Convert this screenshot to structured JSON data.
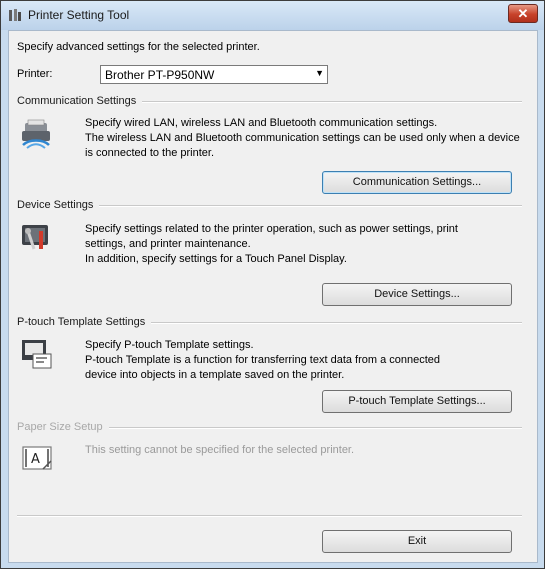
{
  "window": {
    "title": "Printer Setting Tool",
    "close_glyph": "✕"
  },
  "intro": "Specify advanced settings for the selected printer.",
  "printer": {
    "label": "Printer:",
    "value": "Brother PT-P950NW"
  },
  "sections": {
    "communication": {
      "header": "Communication Settings",
      "desc": [
        "Specify wired LAN, wireless LAN and Bluetooth communication settings.",
        "The wireless LAN and Bluetooth communication settings can be used only when a device",
        "is connected to the printer."
      ],
      "button": "Communication Settings...",
      "icon": "printer-network-icon"
    },
    "device": {
      "header": "Device Settings",
      "desc": [
        "Specify settings related to the printer operation, such as power settings, print",
        "settings, and printer maintenance.",
        "In addition, specify settings for a Touch Panel Display."
      ],
      "button": "Device Settings...",
      "icon": "tools-icon"
    },
    "template": {
      "header": "P-touch Template Settings",
      "desc": [
        "Specify P-touch Template settings.",
        "P-touch Template is a function for transferring text data from a connected",
        "device into objects in a template saved on the printer."
      ],
      "button": "P-touch Template Settings...",
      "icon": "template-icon"
    },
    "paper": {
      "header": "Paper Size Setup",
      "desc": [
        "This setting cannot be specified for the selected printer."
      ],
      "icon": "paper-size-icon"
    }
  },
  "exit_button": "Exit"
}
